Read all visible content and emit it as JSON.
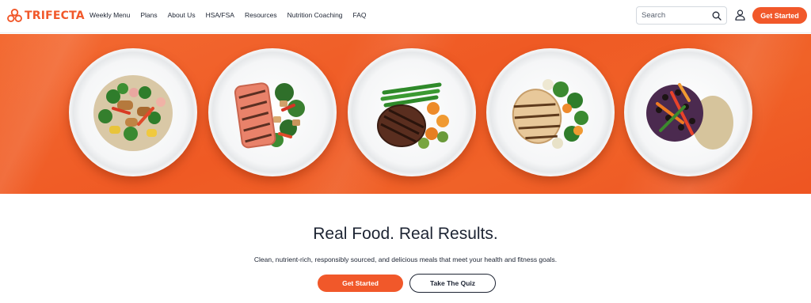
{
  "brand": {
    "name": "TRIFECTA",
    "accent": "#f1582a",
    "text_color": "#1d2433"
  },
  "nav": {
    "items": [
      {
        "label": "Weekly Menu"
      },
      {
        "label": "Plans"
      },
      {
        "label": "About Us"
      },
      {
        "label": "HSA/FSA"
      },
      {
        "label": "Resources"
      },
      {
        "label": "Nutrition Coaching"
      },
      {
        "label": "FAQ"
      }
    ]
  },
  "search": {
    "placeholder": "Search",
    "icon": "search-icon"
  },
  "account": {
    "icon": "user-icon"
  },
  "header_cta": {
    "label": "Get Started"
  },
  "hero": {
    "background": "#ef5a24",
    "plates": [
      {
        "dish": "chicken-stir-fry"
      },
      {
        "dish": "grilled-salmon"
      },
      {
        "dish": "grilled-steak"
      },
      {
        "dish": "grilled-chicken"
      },
      {
        "dish": "black-bean-rice-bowl"
      }
    ]
  },
  "main": {
    "headline": "Real Food. Real Results.",
    "subtext": "Clean, nutrient-rich, responsibly sourced, and delicious meals that meet your health and fitness goals.",
    "primary_cta": "Get Started",
    "secondary_cta": "Take The Quiz"
  }
}
